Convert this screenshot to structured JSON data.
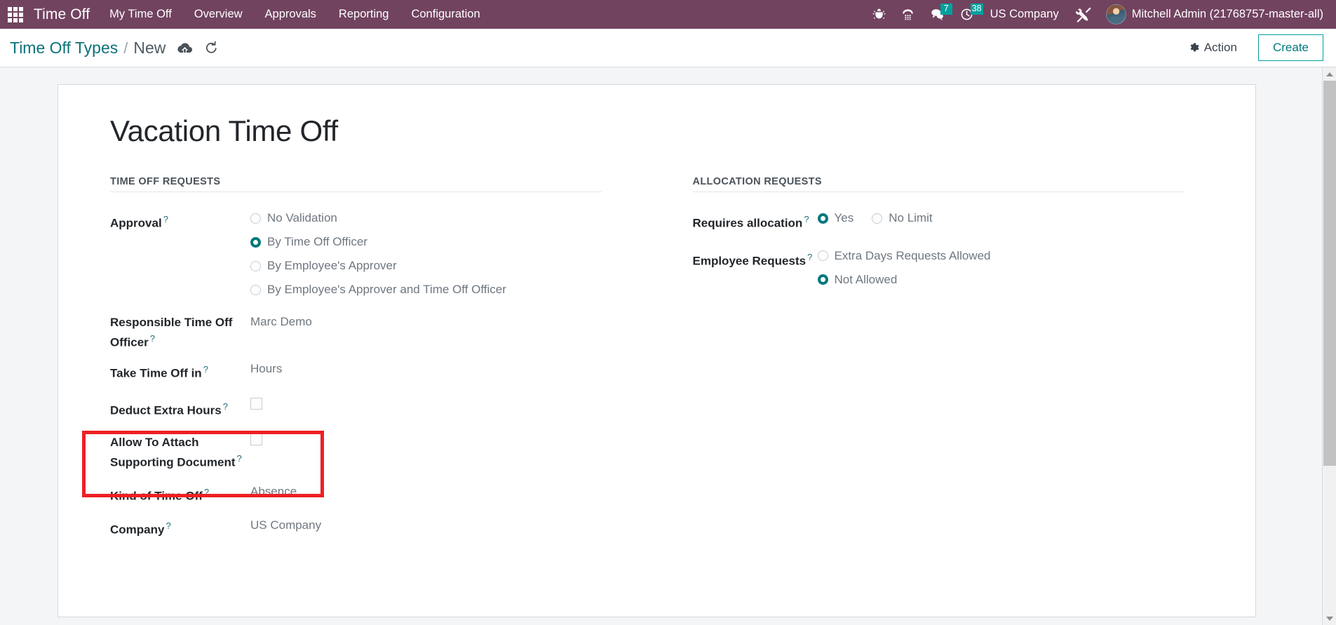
{
  "navbar": {
    "apps_icon": "apps-grid-icon",
    "brand": "Time Off",
    "menu": [
      {
        "label": "My Time Off"
      },
      {
        "label": "Overview"
      },
      {
        "label": "Approvals"
      },
      {
        "label": "Reporting"
      },
      {
        "label": "Configuration"
      }
    ],
    "systray": {
      "bug_icon": "bug-icon",
      "phone_icon": "phone-dialpad-icon",
      "messages_icon": "chat-bubbles-icon",
      "messages_count": "7",
      "activities_icon": "clock-icon",
      "activities_count": "38",
      "company": "US Company",
      "debug_icon": "wrench-screwdriver-icon",
      "user": "Mitchell Admin (21768757-master-all)"
    },
    "accent": "#00a09d",
    "background": "#71435f"
  },
  "control_panel": {
    "breadcrumb_root": "Time Off Types",
    "breadcrumb_sep": "/",
    "breadcrumb_current": "New",
    "save_icon": "cloud-upload-icon",
    "discard_icon": "undo-icon",
    "action_label": "Action",
    "action_icon": "gear-icon",
    "create_label": "Create"
  },
  "record": {
    "title": "Vacation Time Off"
  },
  "left_section": {
    "heading": "TIME OFF REQUESTS",
    "approval": {
      "label": "Approval",
      "help": "?",
      "options": [
        {
          "label": "No Validation",
          "selected": false
        },
        {
          "label": "By Time Off Officer",
          "selected": true
        },
        {
          "label": "By Employee's Approver",
          "selected": false
        },
        {
          "label": "By Employee's Approver and Time Off Officer",
          "selected": false
        }
      ]
    },
    "responsible_officer": {
      "label": "Responsible Time Off Officer",
      "help": "?",
      "value": "Marc Demo"
    },
    "take_time_off_in": {
      "label": "Take Time Off in",
      "help": "?",
      "value": "Hours"
    },
    "deduct_extra_hours": {
      "label": "Deduct Extra Hours",
      "help": "?",
      "checked": false
    },
    "allow_attachment": {
      "label": "Allow To Attach Supporting Document",
      "help": "?",
      "checked": false
    },
    "kind_of_time_off": {
      "label": "Kind of Time Off",
      "help": "?",
      "value": "Absence"
    },
    "company": {
      "label": "Company",
      "help": "?",
      "value": "US Company"
    }
  },
  "right_section": {
    "heading": "ALLOCATION REQUESTS",
    "requires_allocation": {
      "label": "Requires allocation",
      "help": "?",
      "options": [
        {
          "label": "Yes",
          "selected": true
        },
        {
          "label": "No Limit",
          "selected": false
        }
      ]
    },
    "employee_requests": {
      "label": "Employee Requests",
      "help": "?",
      "options": [
        {
          "label": "Extra Days Requests Allowed",
          "selected": false
        },
        {
          "label": "Not Allowed",
          "selected": true
        }
      ]
    }
  },
  "annotation": {
    "highlight_color": "#ee2024",
    "name": "red-highlight-box"
  },
  "scrollbar": {
    "up_icon": "scroll-up-arrow",
    "down_icon": "scroll-down-arrow"
  }
}
